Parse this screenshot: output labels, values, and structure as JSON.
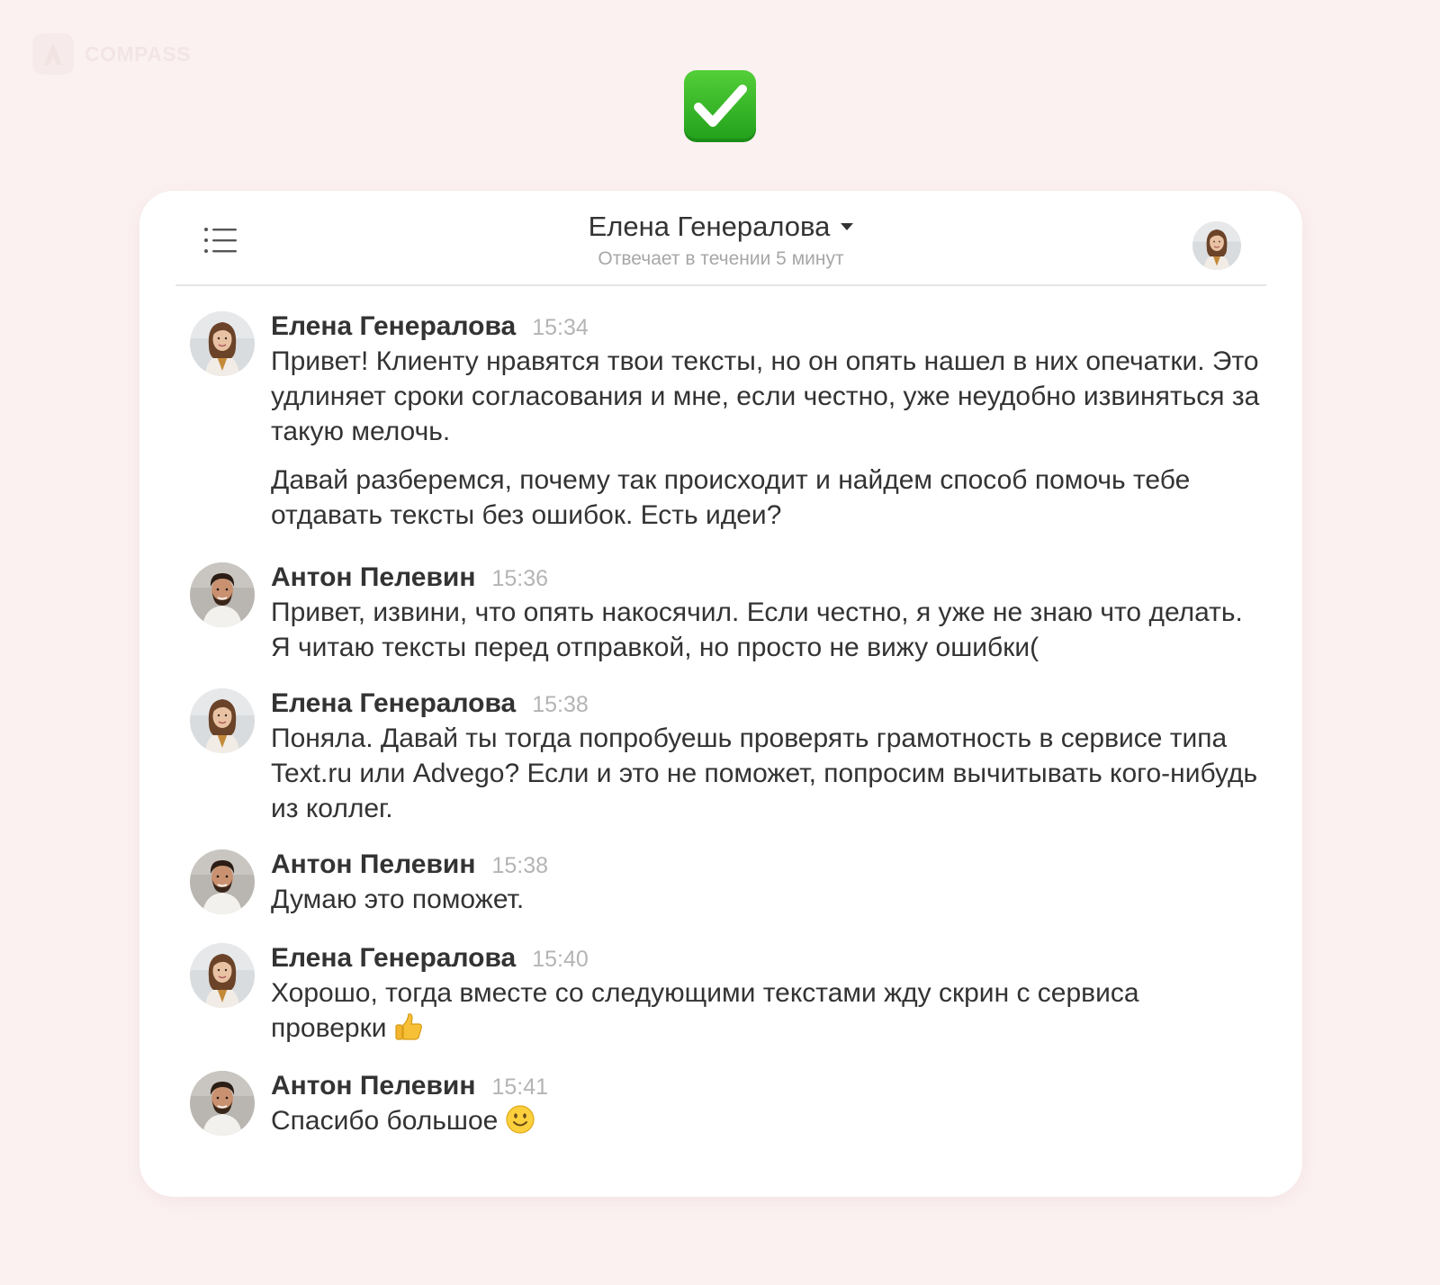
{
  "brand": {
    "name": "COMPASS"
  },
  "badge": {
    "icon": "check-mark-icon",
    "color": "#2dae26"
  },
  "header": {
    "contact_name": "Елена Генералова",
    "status": "Отвечает в течении 5 минут"
  },
  "messages": [
    {
      "author": "Елена Генералова",
      "time": "15:34",
      "avatar": "elena-avatar",
      "paragraphs": [
        "Привет! Клиенту нравятся твои тексты, но он опять нашел в них опечатки. Это удлиняет сроки согласования и мне, если честно, уже неудобно извиняться за такую мелочь.",
        "Давай разберемся, почему так происходит и найдем способ помочь тебе отдавать тексты без ошибок. Есть идеи?"
      ]
    },
    {
      "author": "Антон Пелевин",
      "time": "15:36",
      "avatar": "anton-avatar",
      "paragraphs": [
        "Привет, извини, что опять накосячил. Если честно, я уже не знаю что делать. Я читаю тексты перед отправкой, но просто не вижу ошибки("
      ]
    },
    {
      "author": "Елена Генералова",
      "time": "15:38",
      "avatar": "elena-avatar",
      "paragraphs": [
        "Поняла. Давай ты тогда попробуешь проверять грамотность в сервисе типа Text.ru или Advego? Если и это не поможет, попросим вычитывать кого-нибудь из коллег."
      ]
    },
    {
      "author": "Антон Пелевин",
      "time": "15:38",
      "avatar": "anton-avatar",
      "paragraphs": [
        "Думаю это поможет."
      ]
    },
    {
      "author": "Елена Генералова",
      "time": "15:40",
      "avatar": "elena-avatar",
      "paragraphs": [
        "Хорошо, тогда вместе со следующими текстами жду скрин с сервиса проверки"
      ],
      "emoji": "thumbs-up-icon"
    },
    {
      "author": "Антон Пелевин",
      "time": "15:41",
      "avatar": "anton-avatar",
      "paragraphs": [
        "Спасибо большое"
      ],
      "emoji": "smiley-icon"
    }
  ]
}
